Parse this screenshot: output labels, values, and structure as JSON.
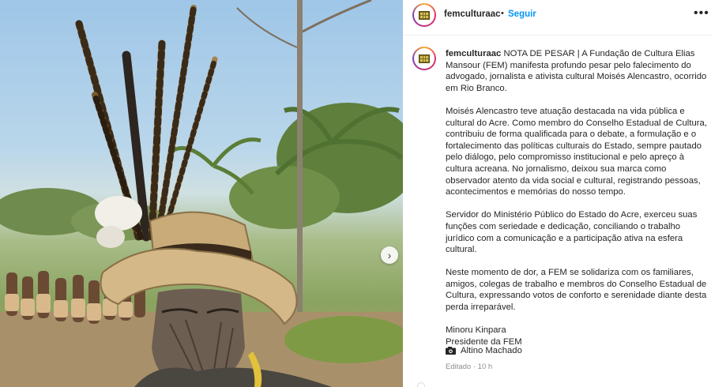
{
  "post": {
    "username": "femculturaac",
    "separator": "•",
    "follow_label": "Seguir",
    "more_icon": "•••",
    "carousel_next_icon": "›"
  },
  "caption": {
    "username": "femculturaac",
    "paragraph_1": "NOTA DE PESAR | A Fundação de Cultura Elias Mansour (FEM) manifesta profundo pesar pelo falecimento do advogado, jornalista e ativista cultural Moisés Alencastro, ocorrido em Rio Branco.",
    "paragraph_2": "Moisés Alencastro teve atuação destacada na vida pública e cultural do Acre. Como membro do Conselho Estadual de Cultura, contribuiu de forma qualificada para o debate, a formulação e o fortalecimento das políticas culturais do Estado, sempre pautado pelo diálogo, pelo compromisso institucional e pelo apreço à cultura acreana. No jornalismo, deixou sua marca como observador atento da vida social e cultural, registrando pessoas, acontecimentos e memórias do nosso tempo.",
    "paragraph_3": "Servidor do Ministério Público do Estado do Acre, exerceu suas funções com seriedade e dedicação, conciliando o trabalho jurídico com a comunicação e a participação ativa na esfera cultural.",
    "paragraph_4": "Neste momento de dor, a FEM se solidariza com os familiares, amigos, colegas de trabalho e membros do Conselho Estadual de Cultura, expressando votos de conforto e serenidade diante desta perda irreparável.",
    "signature_name": "Minoru Kinpara",
    "signature_title": "Presidente da FEM"
  },
  "photo_credit": "Altino Machado",
  "edited_label": "Editado · 10 h",
  "colors": {
    "follow_blue": "#0095f6",
    "text": "#262626",
    "muted": "#8e8e8e",
    "divider": "#efefef"
  }
}
